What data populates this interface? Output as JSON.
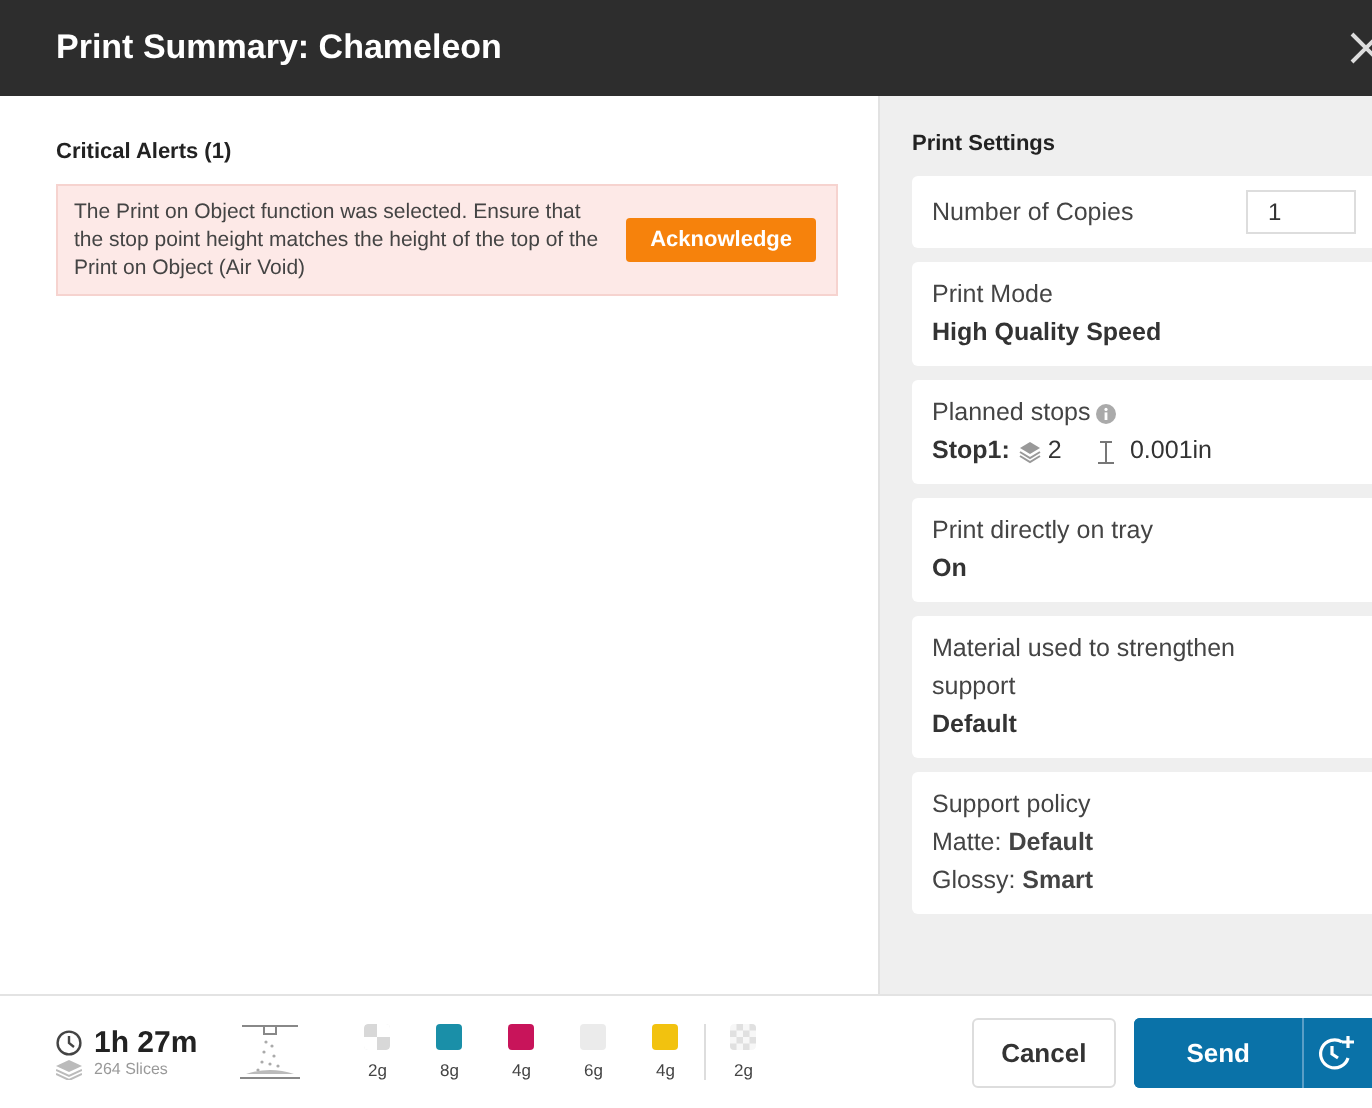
{
  "window": {
    "title": "Print Summary: Chameleon"
  },
  "alerts": {
    "title": "Critical Alerts (1)",
    "items": [
      {
        "message": "The Print on Object function was selected. Ensure that the stop point height matches the height of the top of the Print on Object (Air Void)",
        "action": "Acknowledge"
      }
    ]
  },
  "settings": {
    "title": "Print Settings",
    "cards": [
      {
        "kind": "copies",
        "label": "Number of Copies",
        "value": "1"
      },
      {
        "kind": "value",
        "label": "Print Mode",
        "value": "High Quality Speed"
      },
      {
        "kind": "stops",
        "label": "Planned stops",
        "stop": "Stop1:",
        "layers": "2",
        "height": "0.001in"
      },
      {
        "kind": "value",
        "label": "Print directly on tray",
        "value": "On"
      },
      {
        "kind": "value",
        "label": "Material used to strengthen support",
        "value": "Default"
      },
      {
        "kind": "lines",
        "label": "Support policy",
        "lines": [
          "Matte: **Default**",
          "Glossy: **Smart**"
        ]
      }
    ]
  },
  "footer": {
    "time": "1h 27m",
    "slices": "264 Slices",
    "materials": [
      {
        "kind": "multi",
        "color": "#d8d8d8",
        "amount": "2g"
      },
      {
        "kind": "solid",
        "color": "#1a8fa8",
        "amount": "8g"
      },
      {
        "kind": "solid",
        "color": "#c8145a",
        "amount": "4g"
      },
      {
        "kind": "solid",
        "color": "#ebebeb",
        "amount": "6g"
      },
      {
        "kind": "solid",
        "color": "#f2c20f",
        "amount": "4g"
      },
      {
        "kind": "support",
        "color": "#e0e0e0",
        "amount": "2g"
      }
    ],
    "buttons": {
      "cancel": "Cancel",
      "send": "Send"
    }
  }
}
